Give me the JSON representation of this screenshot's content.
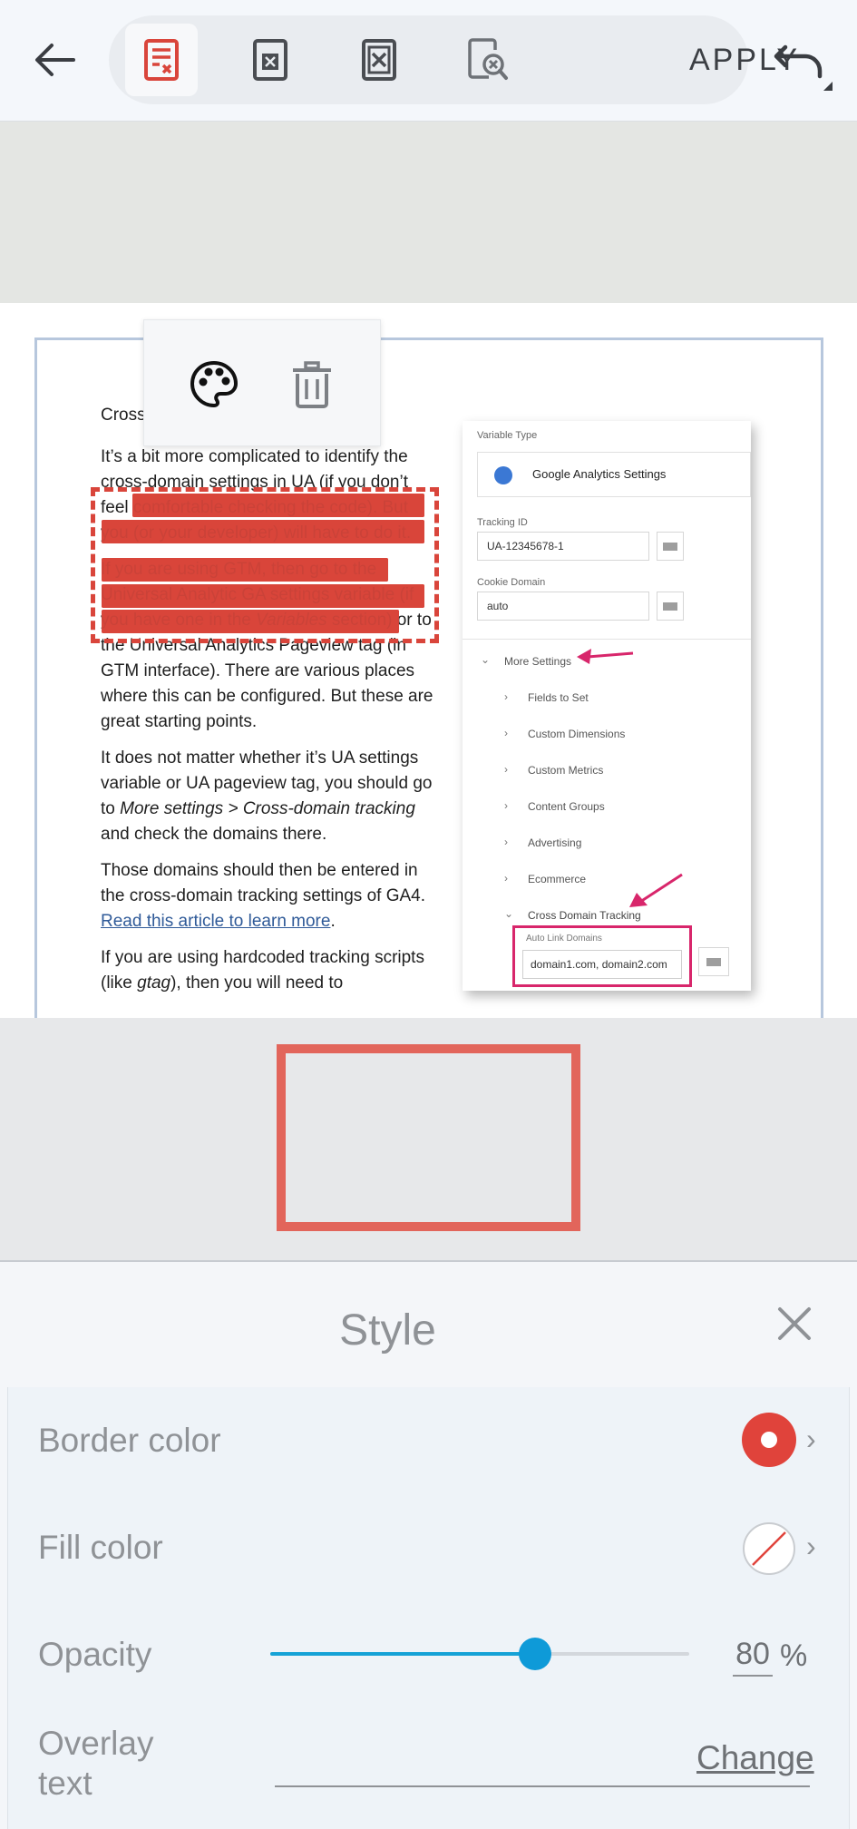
{
  "toolbar": {
    "apply_label": "APPLY",
    "icons": [
      "back-arrow-icon",
      "redact-text-icon",
      "redact-page-icon",
      "redact-box-icon",
      "redact-search-icon",
      "undo-icon"
    ]
  },
  "float_menu": {
    "icons": [
      "palette-icon",
      "trash-icon"
    ]
  },
  "doc": {
    "heading": "Cross",
    "p1": "It’s a bit more complicated to identify the cross-domain settings in UA (if you don’t feel comfortable checking the code). But you (or your developer) will have to do it.",
    "p2_lead": "If you are using GTM, then go to the Universal Analytic GA settings variable (if you have one in the ",
    "p2_em": "Variables",
    "p2_tail": " section) or to the Universal Analytics Pageview tag (in GTM interface). There are various places where this can be configured. But these are great starting points.",
    "p3_lead": "It does not matter whether it’s UA settings variable or UA pageview tag, you should go to ",
    "p3_em": "More settings > Cross-domain tracking",
    "p3_tail": " and check the domains there.",
    "p4_lead": "Those domains should then be entered in the cross-domain tracking settings of GA4. ",
    "p4_link": "Read this article to learn more",
    "p4_tail": ".",
    "p5_lead": "If you are using hardcoded tracking scripts (like ",
    "p5_em": "gtag",
    "p5_tail": "), then you will need to"
  },
  "gtm": {
    "variable_type_label": "Variable Type",
    "variable_type_value": "Google Analytics Settings",
    "tracking_id_label": "Tracking ID",
    "tracking_id_value": "UA-12345678-1",
    "cookie_domain_label": "Cookie Domain",
    "cookie_domain_value": "auto",
    "more_settings": "More Settings",
    "items": [
      "Fields to Set",
      "Custom Dimensions",
      "Custom Metrics",
      "Content Groups",
      "Advertising",
      "Ecommerce"
    ],
    "cross_domain": "Cross Domain Tracking",
    "auto_link_label": "Auto Link Domains",
    "auto_link_value": "domain1.com, domain2.com"
  },
  "panel": {
    "title": "Style",
    "border_color_label": "Border color",
    "fill_color_label": "Fill color",
    "opacity_label": "Opacity",
    "opacity_value": "80",
    "opacity_unit": "%",
    "overlay_label_line1": "Overlay",
    "overlay_label_line2": "text",
    "change_label": "Change"
  },
  "colors": {
    "accent_red": "#d9453b",
    "border_color": "#e0433b",
    "slider": "#0e9ad8",
    "annotation_pink": "#d8266b"
  },
  "opacity_fraction": 0.8
}
